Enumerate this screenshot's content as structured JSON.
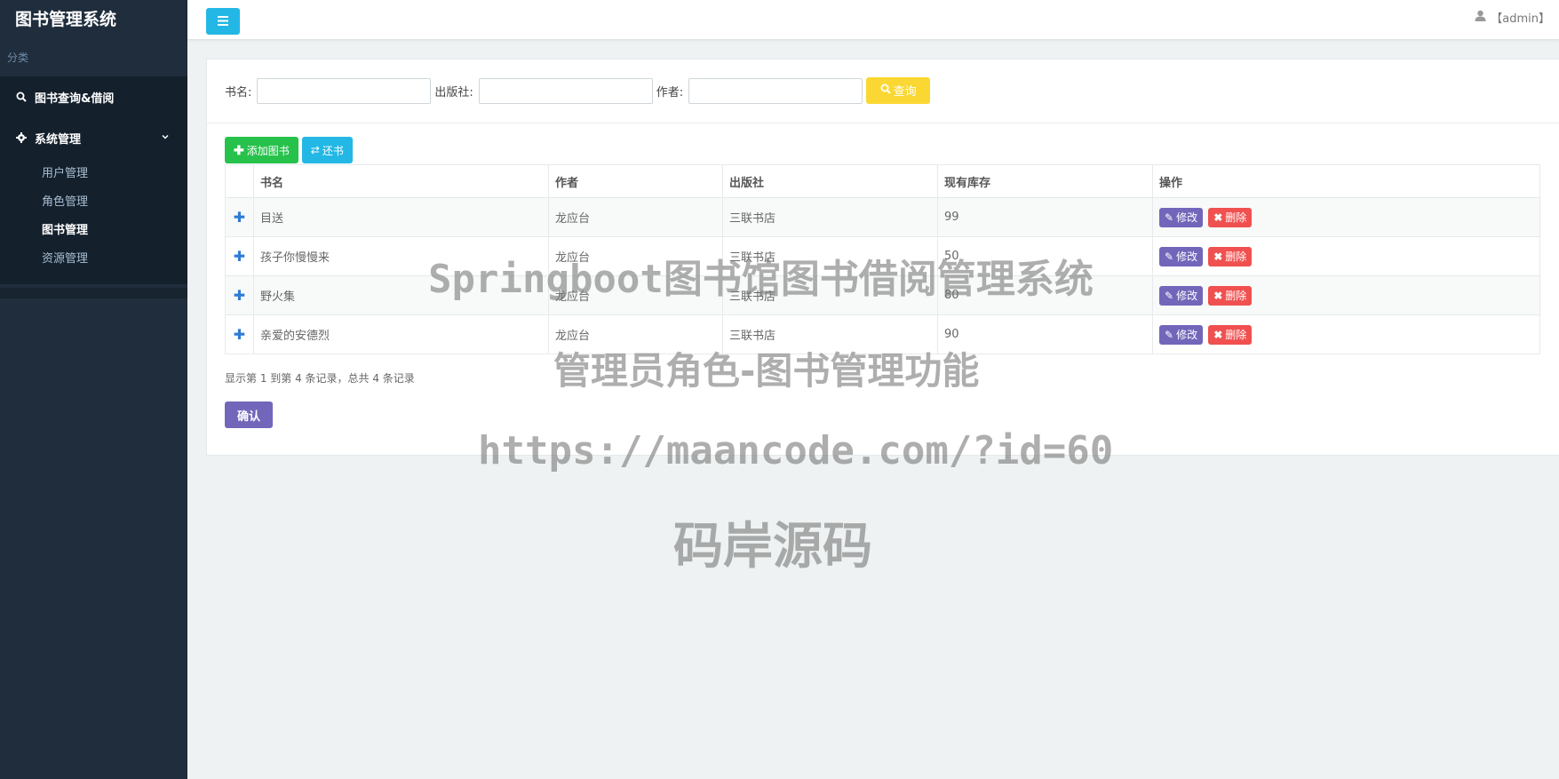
{
  "sidebar": {
    "brand": "图书管理系统",
    "category": "分类",
    "items": [
      {
        "label": "图书查询&借阅"
      },
      {
        "label": "系统管理",
        "children": [
          {
            "label": "用户管理"
          },
          {
            "label": "角色管理"
          },
          {
            "label": "图书管理"
          },
          {
            "label": "资源管理"
          }
        ]
      }
    ]
  },
  "header": {
    "user": "【admin】"
  },
  "search": {
    "book_label": "书名:",
    "publisher_label": "出版社:",
    "author_label": "作者:",
    "book_value": "",
    "publisher_value": "",
    "author_value": "",
    "query_label": "查询"
  },
  "toolbar": {
    "add_label": "添加图书",
    "return_label": "还书"
  },
  "table": {
    "columns": [
      "书名",
      "作者",
      "出版社",
      "现有库存",
      "操作"
    ],
    "rows": [
      {
        "title": "目送",
        "author": "龙应台",
        "publisher": "三联书店",
        "stock": "99"
      },
      {
        "title": "孩子你慢慢来",
        "author": "龙应台",
        "publisher": "三联书店",
        "stock": "50"
      },
      {
        "title": "野火集",
        "author": "龙应台",
        "publisher": "三联书店",
        "stock": "80"
      },
      {
        "title": "亲爱的安德烈",
        "author": "龙应台",
        "publisher": "三联书店",
        "stock": "90"
      }
    ],
    "edit_label": "修改",
    "delete_label": "删除"
  },
  "pagination": {
    "info": "显示第 1 到第 4 条记录，总共 4 条记录"
  },
  "confirm_label": "确认",
  "watermark": {
    "line1": "Springboot图书馆图书借阅管理系统",
    "line2": "管理员角色-图书管理功能",
    "line3": "https://maancode.com/?id=60",
    "line4": "码岸源码"
  },
  "colors": {
    "sidebar": "#1f2d3d",
    "toggle": "#23b7e5",
    "query": "#fad733",
    "add": "#27c24c",
    "edit": "#7266ba",
    "delete": "#f05050"
  },
  "icons": {
    "toggle": "menu-icon",
    "search": "search-icon",
    "settings": "gear-icon",
    "chevron": "chevron-down-icon",
    "user": "user-icon",
    "add": "plus-icon",
    "return": "swap-icon",
    "edit": "edit-icon",
    "delete": "close-icon",
    "expand": "plus-icon"
  }
}
